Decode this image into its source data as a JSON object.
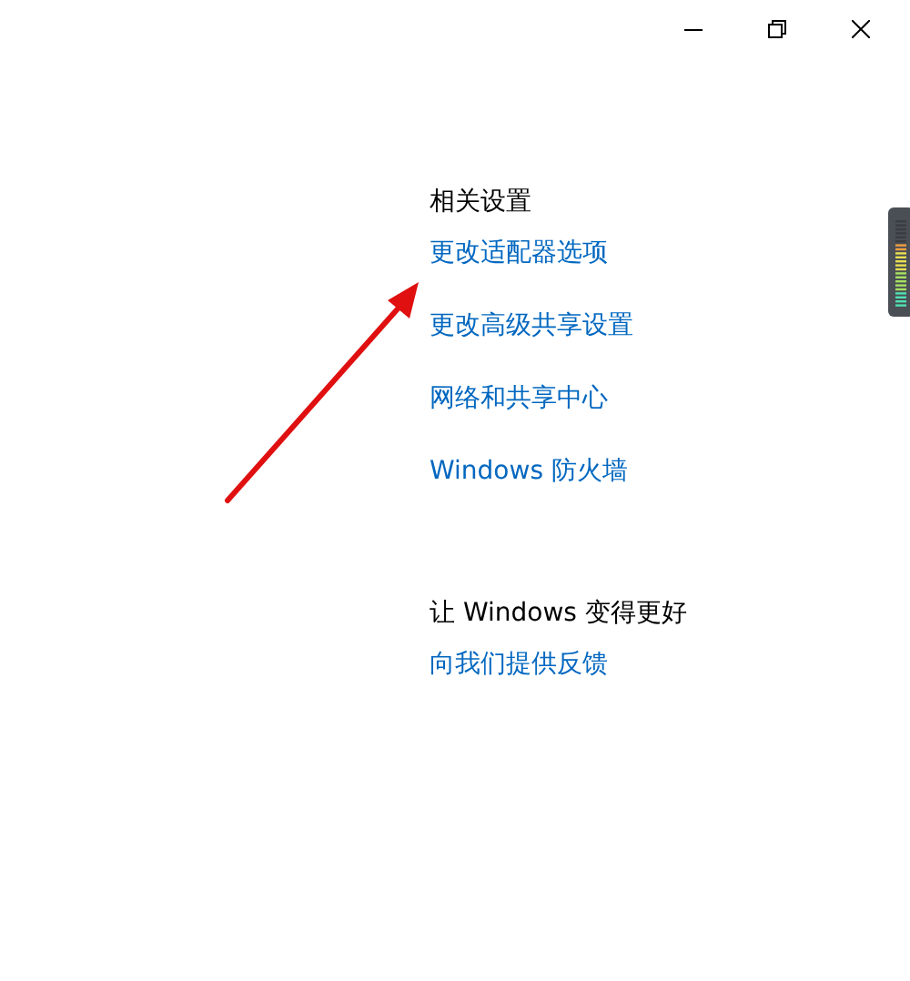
{
  "sections": [
    {
      "heading": "相关设置",
      "links": [
        "更改适配器选项",
        "更改高级共享设置",
        "网络和共享中心",
        "Windows 防火墙"
      ]
    },
    {
      "heading": "让 Windows 变得更好",
      "links": [
        "向我们提供反馈"
      ]
    }
  ]
}
